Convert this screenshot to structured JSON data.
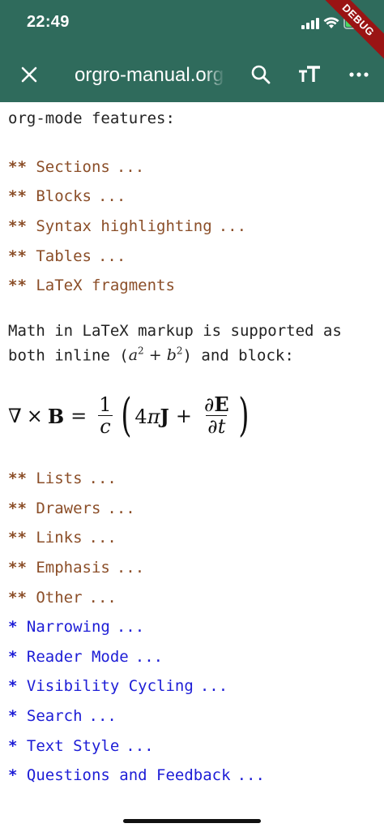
{
  "status_bar": {
    "time": "22:49",
    "debug_banner": "DEBUG"
  },
  "toolbar": {
    "title": "orgro-manual.org",
    "icons": [
      "close-icon",
      "search-icon",
      "text-size-icon",
      "more-icon"
    ]
  },
  "colors": {
    "appbar": "#2f6b5c",
    "section_level2": "#8b4e28",
    "section_level1": "#1d1dd6",
    "text": "#222222"
  },
  "document": {
    "partial_line": "org-mode features:",
    "level2_a": [
      {
        "stars": "**",
        "title": "Sections",
        "ellipsis": "..."
      },
      {
        "stars": "**",
        "title": "Blocks",
        "ellipsis": "..."
      },
      {
        "stars": "**",
        "title": "Syntax highlighting",
        "ellipsis": "..."
      },
      {
        "stars": "**",
        "title": "Tables",
        "ellipsis": "..."
      },
      {
        "stars": "**",
        "title": "LaTeX fragments",
        "ellipsis": ""
      }
    ],
    "math_para": {
      "line1": "Math in LaTeX markup is supported as",
      "line2_prefix": "both inline (",
      "line2_suffix": ") and block:"
    },
    "level2_b": [
      {
        "stars": "**",
        "title": "Lists",
        "ellipsis": "..."
      },
      {
        "stars": "**",
        "title": "Drawers",
        "ellipsis": "..."
      },
      {
        "stars": "**",
        "title": "Links",
        "ellipsis": "..."
      },
      {
        "stars": "**",
        "title": "Emphasis",
        "ellipsis": "..."
      },
      {
        "stars": "**",
        "title": "Other",
        "ellipsis": "..."
      }
    ],
    "level1": [
      {
        "stars": "*",
        "title": "Narrowing",
        "ellipsis": "..."
      },
      {
        "stars": "*",
        "title": "Reader Mode",
        "ellipsis": "..."
      },
      {
        "stars": "*",
        "title": "Visibility Cycling",
        "ellipsis": "..."
      },
      {
        "stars": "*",
        "title": "Search",
        "ellipsis": "..."
      },
      {
        "stars": "*",
        "title": "Text Style",
        "ellipsis": "..."
      },
      {
        "stars": "*",
        "title": "Questions and Feedback",
        "ellipsis": "..."
      }
    ]
  }
}
